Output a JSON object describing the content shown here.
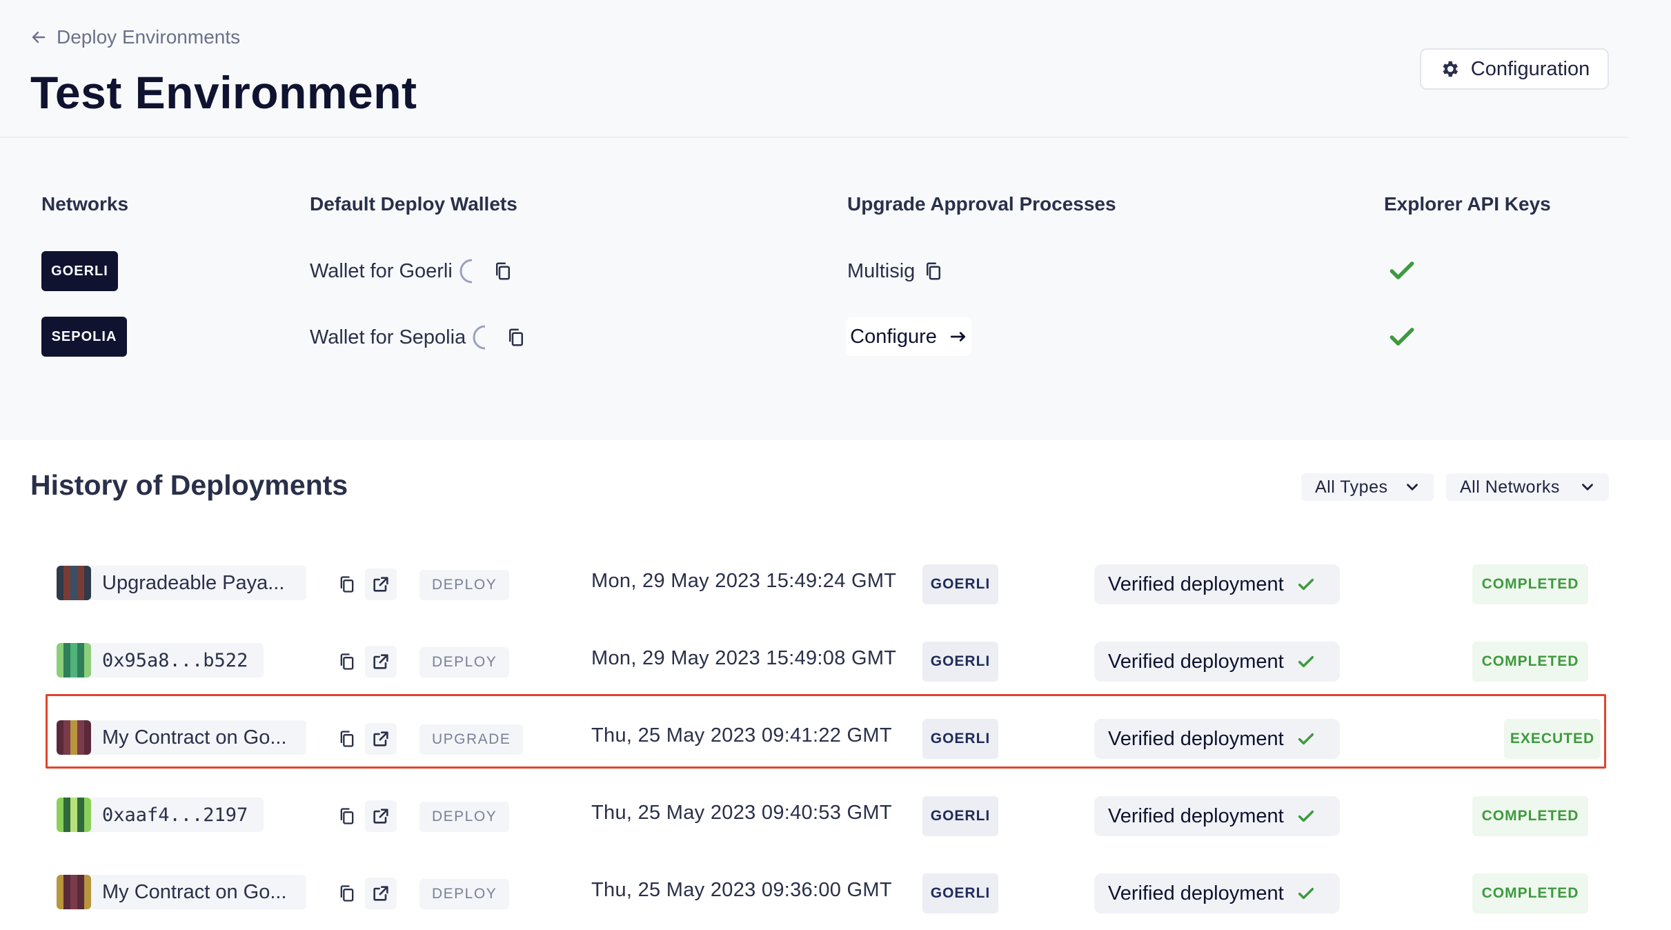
{
  "breadcrumb": {
    "label": "Deploy Environments"
  },
  "page": {
    "title": "Test Environment",
    "config_label": "Configuration"
  },
  "table_headers": {
    "networks": "Networks",
    "wallets": "Default Deploy Wallets",
    "approvals": "Upgrade Approval Processes",
    "api_keys": "Explorer API Keys"
  },
  "networks": [
    {
      "name": "GOERLI",
      "wallet": "Wallet for Goerli",
      "approval": "Multisig",
      "api_key_ok": true
    },
    {
      "name": "SEPOLIA",
      "wallet": "Wallet for Sepolia",
      "approval": "Configure",
      "api_key_ok": true
    }
  ],
  "history": {
    "title": "History of Deployments",
    "filters": {
      "type": "All Types",
      "network": "All Networks"
    },
    "rows": [
      {
        "name": "Upgradeable Paya...",
        "type": "DEPLOY",
        "date": "Mon, 29 May 2023 15:49:24 GMT",
        "network": "GOERLI",
        "verification": "Verified deployment",
        "status": "COMPLETED"
      },
      {
        "name": "0x95a8...b522",
        "type": "DEPLOY",
        "date": "Mon, 29 May 2023 15:49:08 GMT",
        "network": "GOERLI",
        "verification": "Verified deployment",
        "status": "COMPLETED"
      },
      {
        "name": "My Contract on Go...",
        "type": "UPGRADE",
        "date": "Thu, 25 May 2023 09:41:22 GMT",
        "network": "GOERLI",
        "verification": "Verified deployment",
        "status": "EXECUTED"
      },
      {
        "name": "0xaaf4...2197",
        "type": "DEPLOY",
        "date": "Thu, 25 May 2023 09:40:53 GMT",
        "network": "GOERLI",
        "verification": "Verified deployment",
        "status": "COMPLETED"
      },
      {
        "name": "My Contract on Go...",
        "type": "DEPLOY",
        "date": "Thu, 25 May 2023 09:36:00 GMT",
        "network": "GOERLI",
        "verification": "Verified deployment",
        "status": "COMPLETED"
      }
    ]
  },
  "colors": {
    "accent_dark": "#0f1330",
    "success": "#3e9a3e",
    "highlight_border": "#e0432e"
  }
}
